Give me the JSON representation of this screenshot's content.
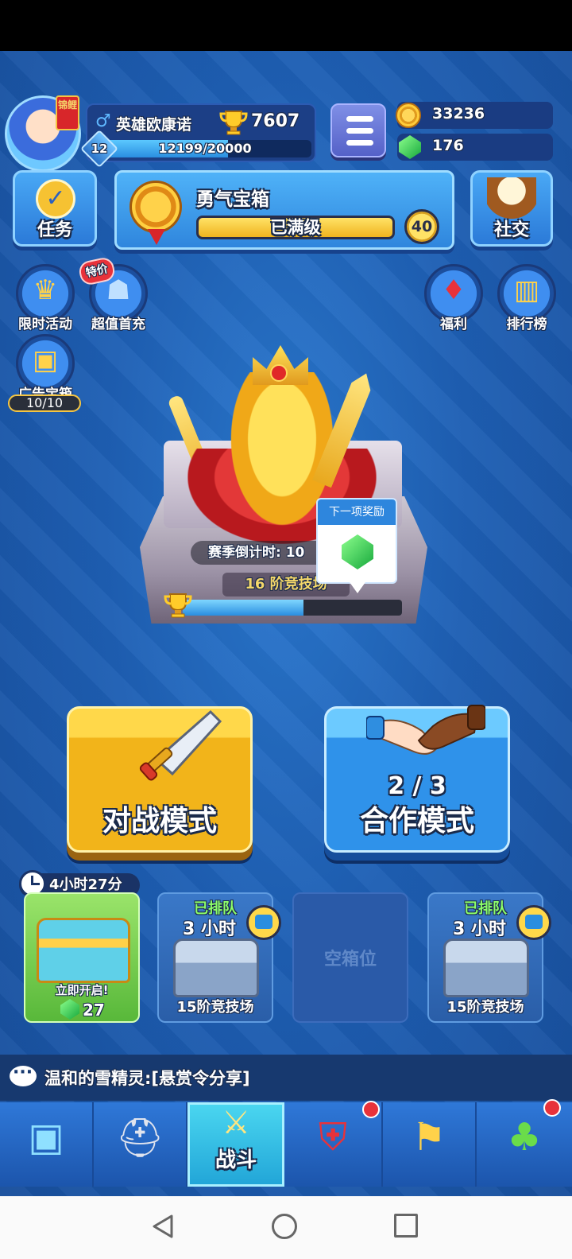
{
  "player": {
    "avatar_badge": "锦鲤",
    "gender_icon": "male-icon",
    "name": "英雄欧康诺",
    "trophies": "7607",
    "level": "12",
    "xp_text": "12199/20000",
    "xp_progress": 0.61
  },
  "currency": {
    "coins": "33236",
    "gems": "176"
  },
  "tasks": {
    "label": "任务"
  },
  "courage_chest": {
    "title": "勇气宝箱",
    "bar_text": "已满级",
    "level": "40"
  },
  "social": {
    "label": "社交"
  },
  "side_buttons": {
    "limited_event": "限时活动",
    "first_recharge": "超值首充",
    "special_tag": "特价",
    "ad_chest": "广告宝箱",
    "ad_counter": "10/10",
    "welfare": "福利",
    "leaderboard": "排行榜"
  },
  "arena": {
    "season_countdown": "赛季倒计时: 10",
    "tier": "16 阶竞技场",
    "progress": 0.55,
    "next_reward_title": "下一项奖励"
  },
  "modes": {
    "battle": "对战模式",
    "coop": "合作模式",
    "coop_count": "2 / 3"
  },
  "chest_slots": {
    "timer": "4小时27分",
    "slot1": {
      "open_now": "立即开启!",
      "cost": "27"
    },
    "slot2": {
      "status": "已排队",
      "time": "3 小时",
      "arena": "15阶竞技场"
    },
    "slot3": {
      "empty": "空箱位"
    },
    "slot4": {
      "status": "已排队",
      "time": "3 小时",
      "arena": "15阶竞技场"
    }
  },
  "chat": {
    "message": "温和的雪精灵:[悬赏令分享]"
  },
  "bottom_nav": {
    "battle_label": "战斗",
    "items": [
      "treasure-chest-icon",
      "knight-helmet-icon",
      "crossed-swords-icon",
      "clan-shield-icon",
      "team-banner-icon",
      "sprout-icon"
    ]
  },
  "colors": {
    "background": "#1e5fb4",
    "gold": "#f2b41a",
    "accent_blue": "#2f92ea",
    "alert_red": "#e8323a"
  }
}
